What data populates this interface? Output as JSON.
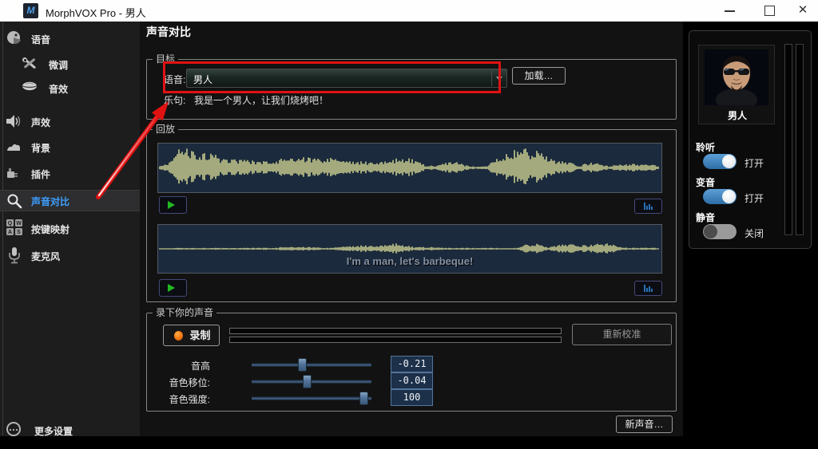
{
  "window": {
    "title": "MorphVOX Pro - 男人",
    "app_icon_letter": "M"
  },
  "sidebar": {
    "items": [
      {
        "label": "语音",
        "icon": "voice-head-icon",
        "indent": 0,
        "selected": false
      },
      {
        "label": "微调",
        "icon": "tools-icon",
        "indent": 1,
        "selected": false
      },
      {
        "label": "音效",
        "icon": "lips-icon",
        "indent": 1,
        "selected": false
      },
      {
        "label": "声效",
        "icon": "speaker-icon",
        "indent": 0,
        "selected": false
      },
      {
        "label": "背景",
        "icon": "cloud-icon",
        "indent": 0,
        "selected": false
      },
      {
        "label": "插件",
        "icon": "plugin-icon",
        "indent": 0,
        "selected": false
      },
      {
        "label": "声音对比",
        "icon": "magnifier-icon",
        "indent": 0,
        "selected": true
      },
      {
        "label": "按键映射",
        "icon": "hotkeys-icon",
        "indent": 0,
        "selected": false
      },
      {
        "label": "麦克风",
        "icon": "microphone-icon",
        "indent": 0,
        "selected": false
      }
    ],
    "more_settings": {
      "label": "更多设置",
      "icon": "more-settings-icon"
    }
  },
  "main": {
    "page_title": "声音对比",
    "target_group": {
      "legend": "目标",
      "voice_label": "语音:",
      "voice_value": "男人",
      "load_button": "加载…",
      "phrase_label": "乐句:",
      "phrase_value": "我是一个男人，让我们烧烤吧！"
    },
    "playback_group": {
      "legend": "回放"
    },
    "record_group": {
      "legend": "录下你的声音",
      "record_button": "录制",
      "recalibrate_button": "重新校准",
      "sliders": [
        {
          "label": "音高",
          "value": "-0.21",
          "pos": 0.42
        },
        {
          "label": "音色移位:",
          "value": "-0.04",
          "pos": 0.46
        },
        {
          "label": "音色强度:",
          "value": "100",
          "pos": 0.97
        }
      ]
    },
    "new_voice_button": "新声音…"
  },
  "right_panel": {
    "avatar_label": "男人",
    "toggles": [
      {
        "label": "聆听",
        "state_label": "打开",
        "on": true
      },
      {
        "label": "变音",
        "state_label": "打开",
        "on": true
      },
      {
        "label": "静音",
        "state_label": "关闭",
        "on": false
      }
    ]
  },
  "waveforms": [
    {
      "amp": 0.95,
      "envelope": [
        0.06,
        0.3,
        0.85,
        0.95,
        0.7,
        0.8,
        0.5,
        0.45,
        0.4,
        0.35,
        0.3,
        0.35,
        0.45,
        0.5,
        0.55,
        0.5,
        0.45,
        0.5,
        0.4,
        0.35,
        0.3,
        0.28,
        0.3,
        0.45,
        0.5,
        0.4,
        0.15,
        0.1,
        0.25,
        0.3,
        0.12,
        0.06,
        0.08,
        0.5,
        0.8,
        1.0,
        0.9,
        0.85,
        0.6,
        0.35,
        0.3,
        0.1,
        0.25,
        0.2,
        0.08,
        0.18,
        0.2,
        0.18,
        0.15,
        0.1
      ]
    },
    {
      "amp": 0.8,
      "caption": "I'm a man, let's barbeque!",
      "envelope": [
        0.05,
        0.05,
        0.06,
        0.05,
        0.06,
        0.05,
        0.06,
        0.05,
        0.05,
        0.06,
        0.06,
        0.07,
        0.1,
        0.12,
        0.12,
        0.1,
        0.07,
        0.06,
        0.15,
        0.18,
        0.2,
        0.18,
        0.2,
        0.35,
        0.22,
        0.1,
        0.12,
        0.1,
        0.06,
        0.05,
        0.06,
        0.05,
        0.06,
        0.06,
        0.05,
        0.06,
        0.28,
        0.3,
        0.1,
        0.25,
        0.28,
        0.22,
        0.2,
        0.3,
        0.32,
        0.12,
        0.06,
        0.07,
        0.06,
        0.05
      ]
    }
  ],
  "icons": [
    "minimize-icon",
    "maximize-icon",
    "close-icon",
    "play-icon",
    "spectrum-icon",
    "record-dot-icon",
    "dropdown-caret-icon"
  ],
  "colors": {
    "accent_blue": "#3f9fff",
    "waveform_yellow": "#efefa0",
    "wave_background": "#1b2a3c",
    "annotation_red": "#e01212",
    "toggle_on_blue": "#3f87c9",
    "record_orange": "#ef7211"
  }
}
